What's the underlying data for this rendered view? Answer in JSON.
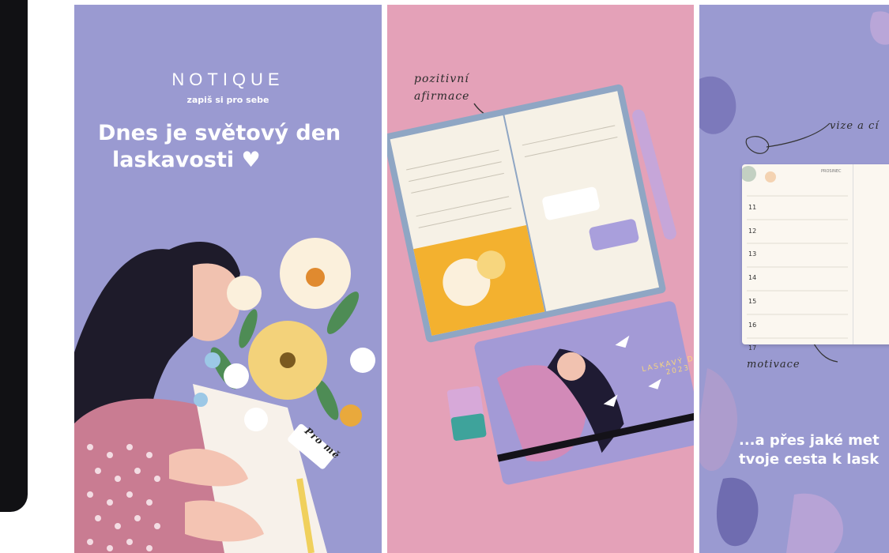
{
  "panel_1": {
    "brand_name": "NOTIQUE",
    "tagline": "zapiš si pro sebe",
    "headline_line1": "Dnes je světový den",
    "headline_line2": "laskavosti ♥",
    "tag_text": "Pro mě"
  },
  "panel_2": {
    "annotation_line1": "pozitivní",
    "annotation_line2": "afirmace",
    "cover_text_line1": "LASKAVÝ DIÁŘ",
    "cover_text_line2": "2023"
  },
  "panel_3": {
    "annotation_top": "vize a cí",
    "annotation_bottom": "motivace",
    "caption_line1": "...a přes jaké met",
    "caption_line2": "tvoje cesta k lask",
    "planner_day_numbers": [
      "11",
      "12",
      "13",
      "14",
      "15",
      "16",
      "17"
    ],
    "planner_header": "PROSINEC"
  },
  "colors": {
    "lavender": "#9a9ad1",
    "pink": "#e4a1b8",
    "dark": "#111114"
  }
}
